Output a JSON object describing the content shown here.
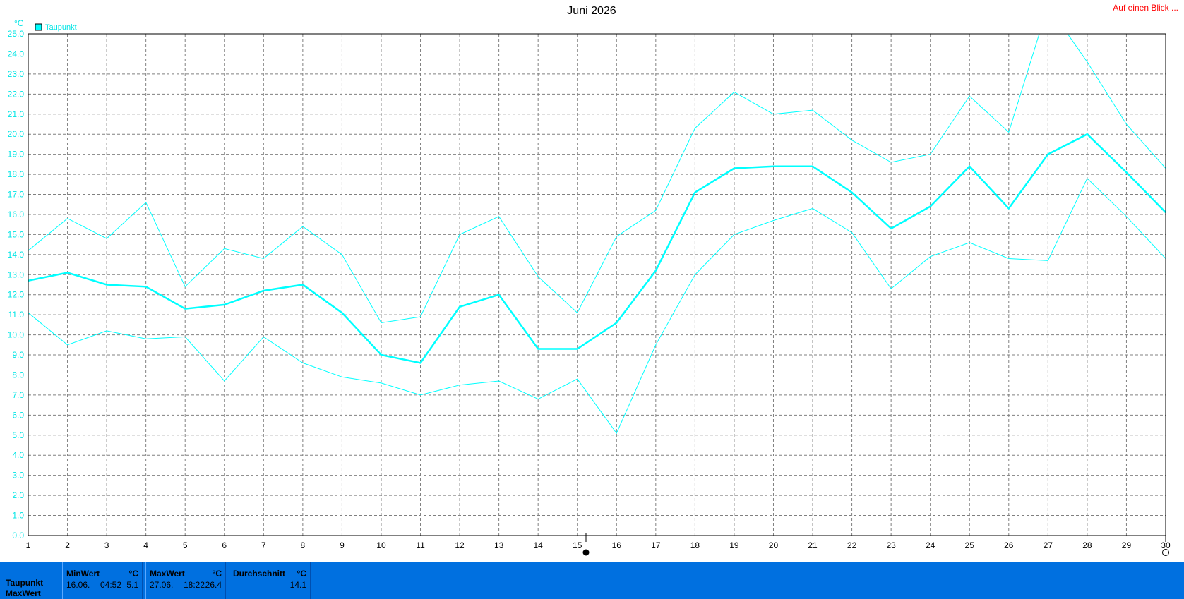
{
  "header": {
    "title": "Juni 2026",
    "link": "Auf einen Blick ..."
  },
  "legend": {
    "label": "Taupunkt",
    "unit": "°C"
  },
  "colors": {
    "series": "#00ffff",
    "grid": "#808080",
    "stats_bg": "#0070e0",
    "link": "#ff0000"
  },
  "chart_data": {
    "type": "line",
    "title": "Juni 2026",
    "ylabel": "°C",
    "xlabel": "",
    "ylim": [
      0,
      25
    ],
    "y_ticks": [
      "0.0",
      "1.0",
      "2.0",
      "3.0",
      "4.0",
      "5.0",
      "6.0",
      "7.0",
      "8.0",
      "9.0",
      "10.0",
      "11.0",
      "12.0",
      "13.0",
      "14.0",
      "15.0",
      "16.0",
      "17.0",
      "18.0",
      "19.0",
      "20.0",
      "21.0",
      "22.0",
      "23.0",
      "24.0",
      "25.0"
    ],
    "x": [
      1,
      2,
      3,
      4,
      5,
      6,
      7,
      8,
      9,
      10,
      11,
      12,
      13,
      14,
      15,
      16,
      17,
      18,
      19,
      20,
      21,
      22,
      23,
      24,
      25,
      26,
      27,
      28,
      29,
      30
    ],
    "grid": true,
    "legend_position": "top-left",
    "series": [
      {
        "name": "Taupunkt",
        "role": "max",
        "values": [
          14.2,
          15.8,
          14.8,
          16.6,
          12.4,
          14.3,
          13.8,
          15.4,
          14.0,
          10.6,
          10.9,
          15.0,
          15.9,
          12.9,
          11.1,
          14.9,
          16.2,
          20.3,
          22.1,
          21.0,
          21.2,
          19.7,
          18.6,
          19.0,
          21.9,
          20.1,
          26.4,
          23.6,
          20.5,
          18.3
        ]
      },
      {
        "name": "Taupunkt",
        "role": "avg",
        "values": [
          12.7,
          13.1,
          12.5,
          12.4,
          11.3,
          11.5,
          12.2,
          12.5,
          11.1,
          9.0,
          8.6,
          11.4,
          12.0,
          9.3,
          9.3,
          10.6,
          13.2,
          17.1,
          18.3,
          18.4,
          18.4,
          17.1,
          15.3,
          16.4,
          18.4,
          16.3,
          19.0,
          20.0,
          18.1,
          16.1
        ]
      },
      {
        "name": "Taupunkt",
        "role": "min",
        "values": [
          11.1,
          9.5,
          10.2,
          9.8,
          9.9,
          7.7,
          9.9,
          8.6,
          7.9,
          7.6,
          7.0,
          7.5,
          7.7,
          6.8,
          7.8,
          5.1,
          9.5,
          13.0,
          15.0,
          15.7,
          16.3,
          15.1,
          12.3,
          13.9,
          14.6,
          13.8,
          13.7,
          17.8,
          15.9,
          13.8
        ]
      }
    ]
  },
  "stats": {
    "row_label_1": "Taupunkt",
    "row_label_2": "MaxWert",
    "min": {
      "header": "MinWert",
      "unit": "°C",
      "date": "16.06.",
      "time": "04:52",
      "value": "5.1"
    },
    "max": {
      "header": "MaxWert",
      "unit": "°C",
      "date": "27.06.",
      "time": "18:22",
      "value": "26.4"
    },
    "avg": {
      "header": "Durchschnitt",
      "unit": "°C",
      "value": "14.1"
    }
  }
}
